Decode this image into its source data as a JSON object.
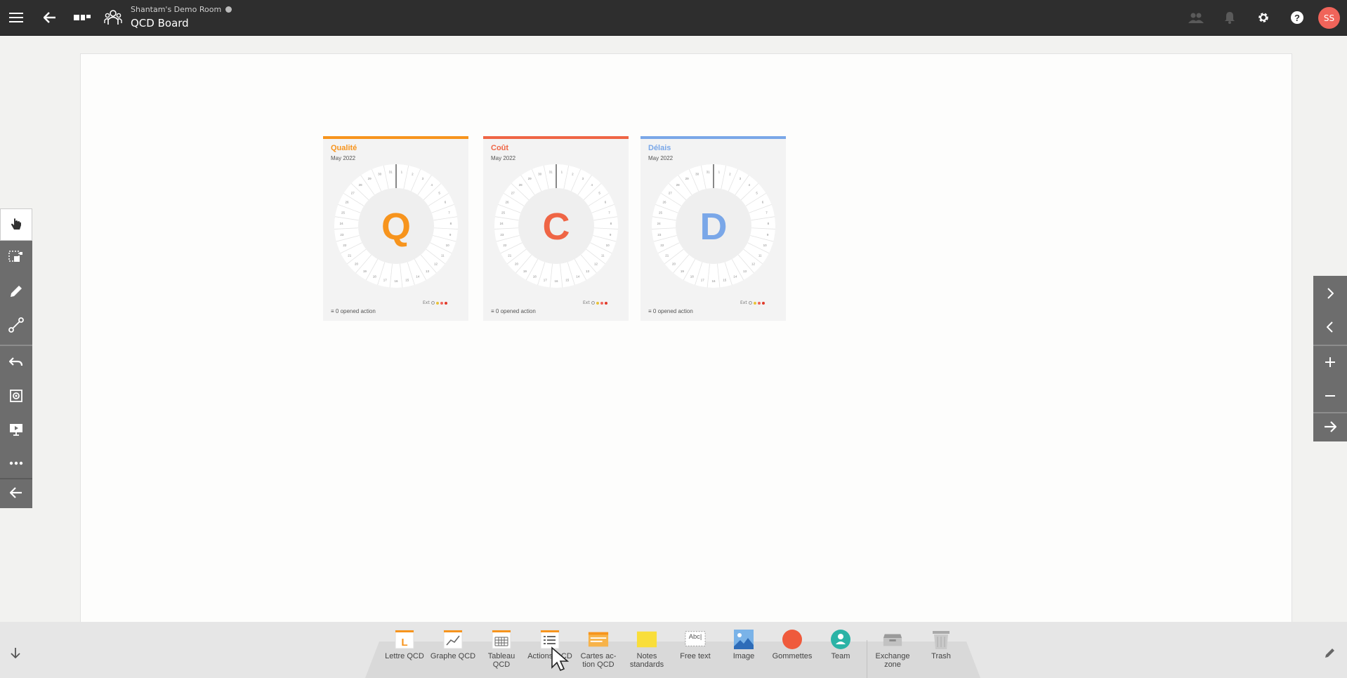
{
  "header": {
    "room_name": "Shantam's Demo Room",
    "board_title": "QCD Board",
    "avatar_initials": "SS"
  },
  "cards": [
    {
      "title": "Qualité",
      "date": "May 2022",
      "letter": "Q",
      "color": "#f7941d",
      "footer": "0 opened action"
    },
    {
      "title": "Coût",
      "date": "May 2022",
      "letter": "C",
      "color": "#ef6545",
      "footer": "0 opened action"
    },
    {
      "title": "Délais",
      "date": "May 2022",
      "letter": "D",
      "color": "#7aa7e8",
      "footer": "0 opened action"
    }
  ],
  "dial_days": [
    "1",
    "2",
    "3",
    "4",
    "5",
    "6",
    "7",
    "8",
    "9",
    "10",
    "11",
    "12",
    "13",
    "14",
    "15",
    "16",
    "17",
    "18",
    "19",
    "20",
    "21",
    "22",
    "23",
    "24",
    "25",
    "26",
    "27",
    "28",
    "29",
    "30",
    "31"
  ],
  "legend_label": "Ext",
  "tray": [
    {
      "label": "Lettre QCD",
      "icon": "lettre-qcd-icon"
    },
    {
      "label": "Graphe QCD",
      "icon": "graphe-qcd-icon"
    },
    {
      "label": "Tableau QCD",
      "icon": "tableau-qcd-icon"
    },
    {
      "label": "Actions QCD",
      "icon": "actions-qcd-icon"
    },
    {
      "label": "Cartes ac-tion QCD",
      "icon": "cartes-action-qcd-icon"
    },
    {
      "label": "Notes standards",
      "icon": "sticky-note-icon"
    },
    {
      "label": "Free text",
      "icon": "free-text-icon"
    },
    {
      "label": "Image",
      "icon": "image-icon"
    },
    {
      "label": "Gommettes",
      "icon": "sticker-dot-icon"
    },
    {
      "label": "Team",
      "icon": "team-icon"
    },
    {
      "label": "Exchange zone",
      "icon": "exchange-zone-icon"
    },
    {
      "label": "Trash",
      "icon": "trash-icon"
    }
  ],
  "free_text_sample": "Abc|",
  "colors": {
    "topbar": "#2e2e2e",
    "toolbar": "#6d6d6d",
    "accent_avatar": "#f0645a",
    "sticker": "#ef5a3c",
    "team": "#2bb3a6",
    "note": "#f9de3a"
  }
}
